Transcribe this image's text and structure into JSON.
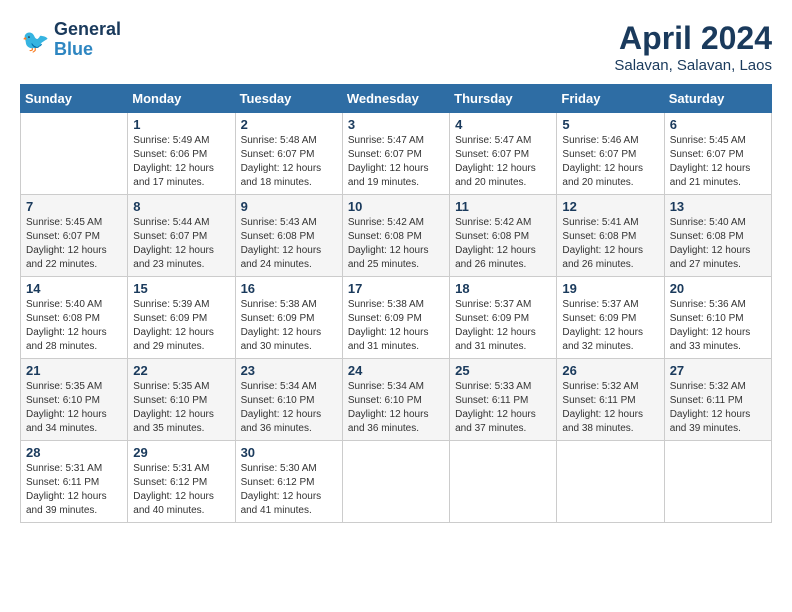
{
  "header": {
    "logo": "GeneralBlue",
    "month": "April 2024",
    "location": "Salavan, Salavan, Laos"
  },
  "days_of_week": [
    "Sunday",
    "Monday",
    "Tuesday",
    "Wednesday",
    "Thursday",
    "Friday",
    "Saturday"
  ],
  "weeks": [
    [
      {
        "day": "",
        "info": ""
      },
      {
        "day": "1",
        "info": "Sunrise: 5:49 AM\nSunset: 6:06 PM\nDaylight: 12 hours and 17 minutes."
      },
      {
        "day": "2",
        "info": "Sunrise: 5:48 AM\nSunset: 6:07 PM\nDaylight: 12 hours and 18 minutes."
      },
      {
        "day": "3",
        "info": "Sunrise: 5:47 AM\nSunset: 6:07 PM\nDaylight: 12 hours and 19 minutes."
      },
      {
        "day": "4",
        "info": "Sunrise: 5:47 AM\nSunset: 6:07 PM\nDaylight: 12 hours and 20 minutes."
      },
      {
        "day": "5",
        "info": "Sunrise: 5:46 AM\nSunset: 6:07 PM\nDaylight: 12 hours and 20 minutes."
      },
      {
        "day": "6",
        "info": "Sunrise: 5:45 AM\nSunset: 6:07 PM\nDaylight: 12 hours and 21 minutes."
      }
    ],
    [
      {
        "day": "7",
        "info": "Sunrise: 5:45 AM\nSunset: 6:07 PM\nDaylight: 12 hours and 22 minutes."
      },
      {
        "day": "8",
        "info": "Sunrise: 5:44 AM\nSunset: 6:07 PM\nDaylight: 12 hours and 23 minutes."
      },
      {
        "day": "9",
        "info": "Sunrise: 5:43 AM\nSunset: 6:08 PM\nDaylight: 12 hours and 24 minutes."
      },
      {
        "day": "10",
        "info": "Sunrise: 5:42 AM\nSunset: 6:08 PM\nDaylight: 12 hours and 25 minutes."
      },
      {
        "day": "11",
        "info": "Sunrise: 5:42 AM\nSunset: 6:08 PM\nDaylight: 12 hours and 26 minutes."
      },
      {
        "day": "12",
        "info": "Sunrise: 5:41 AM\nSunset: 6:08 PM\nDaylight: 12 hours and 26 minutes."
      },
      {
        "day": "13",
        "info": "Sunrise: 5:40 AM\nSunset: 6:08 PM\nDaylight: 12 hours and 27 minutes."
      }
    ],
    [
      {
        "day": "14",
        "info": "Sunrise: 5:40 AM\nSunset: 6:08 PM\nDaylight: 12 hours and 28 minutes."
      },
      {
        "day": "15",
        "info": "Sunrise: 5:39 AM\nSunset: 6:09 PM\nDaylight: 12 hours and 29 minutes."
      },
      {
        "day": "16",
        "info": "Sunrise: 5:38 AM\nSunset: 6:09 PM\nDaylight: 12 hours and 30 minutes."
      },
      {
        "day": "17",
        "info": "Sunrise: 5:38 AM\nSunset: 6:09 PM\nDaylight: 12 hours and 31 minutes."
      },
      {
        "day": "18",
        "info": "Sunrise: 5:37 AM\nSunset: 6:09 PM\nDaylight: 12 hours and 31 minutes."
      },
      {
        "day": "19",
        "info": "Sunrise: 5:37 AM\nSunset: 6:09 PM\nDaylight: 12 hours and 32 minutes."
      },
      {
        "day": "20",
        "info": "Sunrise: 5:36 AM\nSunset: 6:10 PM\nDaylight: 12 hours and 33 minutes."
      }
    ],
    [
      {
        "day": "21",
        "info": "Sunrise: 5:35 AM\nSunset: 6:10 PM\nDaylight: 12 hours and 34 minutes."
      },
      {
        "day": "22",
        "info": "Sunrise: 5:35 AM\nSunset: 6:10 PM\nDaylight: 12 hours and 35 minutes."
      },
      {
        "day": "23",
        "info": "Sunrise: 5:34 AM\nSunset: 6:10 PM\nDaylight: 12 hours and 36 minutes."
      },
      {
        "day": "24",
        "info": "Sunrise: 5:34 AM\nSunset: 6:10 PM\nDaylight: 12 hours and 36 minutes."
      },
      {
        "day": "25",
        "info": "Sunrise: 5:33 AM\nSunset: 6:11 PM\nDaylight: 12 hours and 37 minutes."
      },
      {
        "day": "26",
        "info": "Sunrise: 5:32 AM\nSunset: 6:11 PM\nDaylight: 12 hours and 38 minutes."
      },
      {
        "day": "27",
        "info": "Sunrise: 5:32 AM\nSunset: 6:11 PM\nDaylight: 12 hours and 39 minutes."
      }
    ],
    [
      {
        "day": "28",
        "info": "Sunrise: 5:31 AM\nSunset: 6:11 PM\nDaylight: 12 hours and 39 minutes."
      },
      {
        "day": "29",
        "info": "Sunrise: 5:31 AM\nSunset: 6:12 PM\nDaylight: 12 hours and 40 minutes."
      },
      {
        "day": "30",
        "info": "Sunrise: 5:30 AM\nSunset: 6:12 PM\nDaylight: 12 hours and 41 minutes."
      },
      {
        "day": "",
        "info": ""
      },
      {
        "day": "",
        "info": ""
      },
      {
        "day": "",
        "info": ""
      },
      {
        "day": "",
        "info": ""
      }
    ]
  ]
}
